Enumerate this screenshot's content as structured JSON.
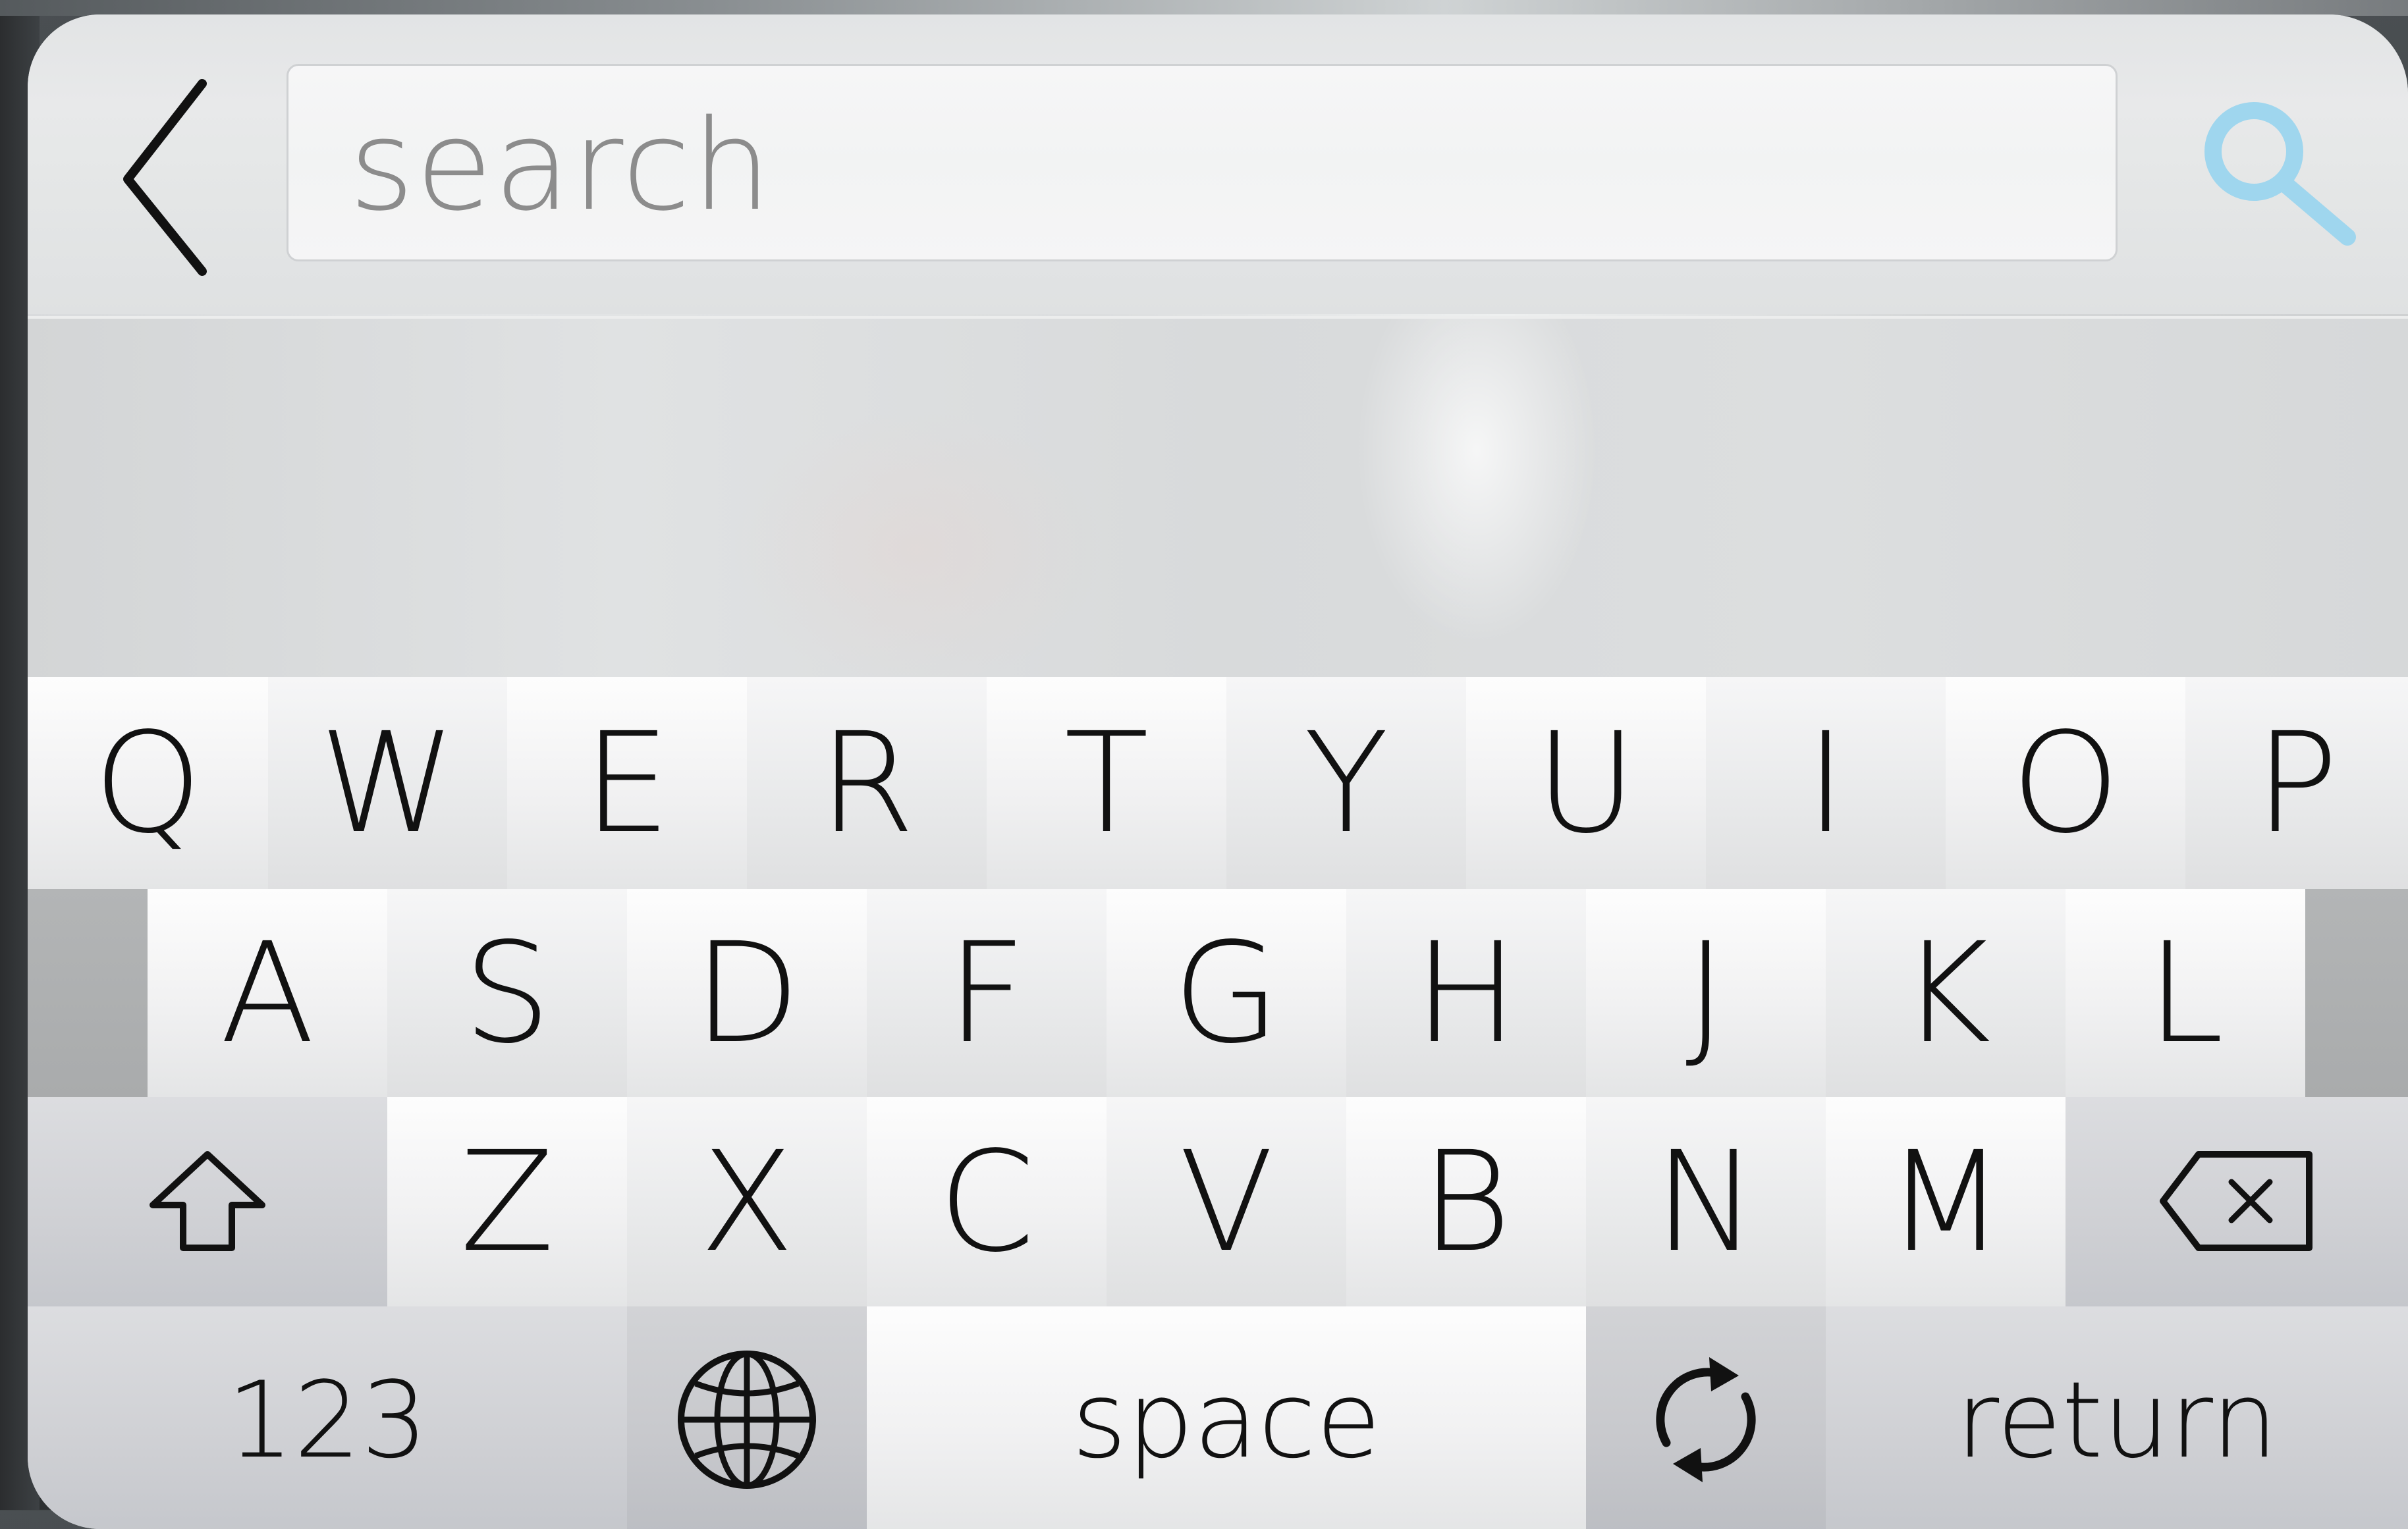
{
  "search": {
    "placeholder": "search",
    "value": "",
    "search_icon_color": "#9fd6ee"
  },
  "keyboard": {
    "row1": [
      "Q",
      "W",
      "E",
      "R",
      "T",
      "Y",
      "U",
      "I",
      "O",
      "P"
    ],
    "row2": [
      "A",
      "S",
      "D",
      "F",
      "G",
      "H",
      "J",
      "K",
      "L"
    ],
    "row3": [
      "Z",
      "X",
      "C",
      "V",
      "B",
      "N",
      "M"
    ],
    "numbers_label": "123",
    "space_label": "space",
    "return_label": "return"
  },
  "icons": {
    "back": "chevron-left-icon",
    "search": "magnifier-icon",
    "shift": "shift-arrow-icon",
    "backspace": "backspace-icon",
    "globe": "globe-icon",
    "refresh": "refresh-icon"
  }
}
